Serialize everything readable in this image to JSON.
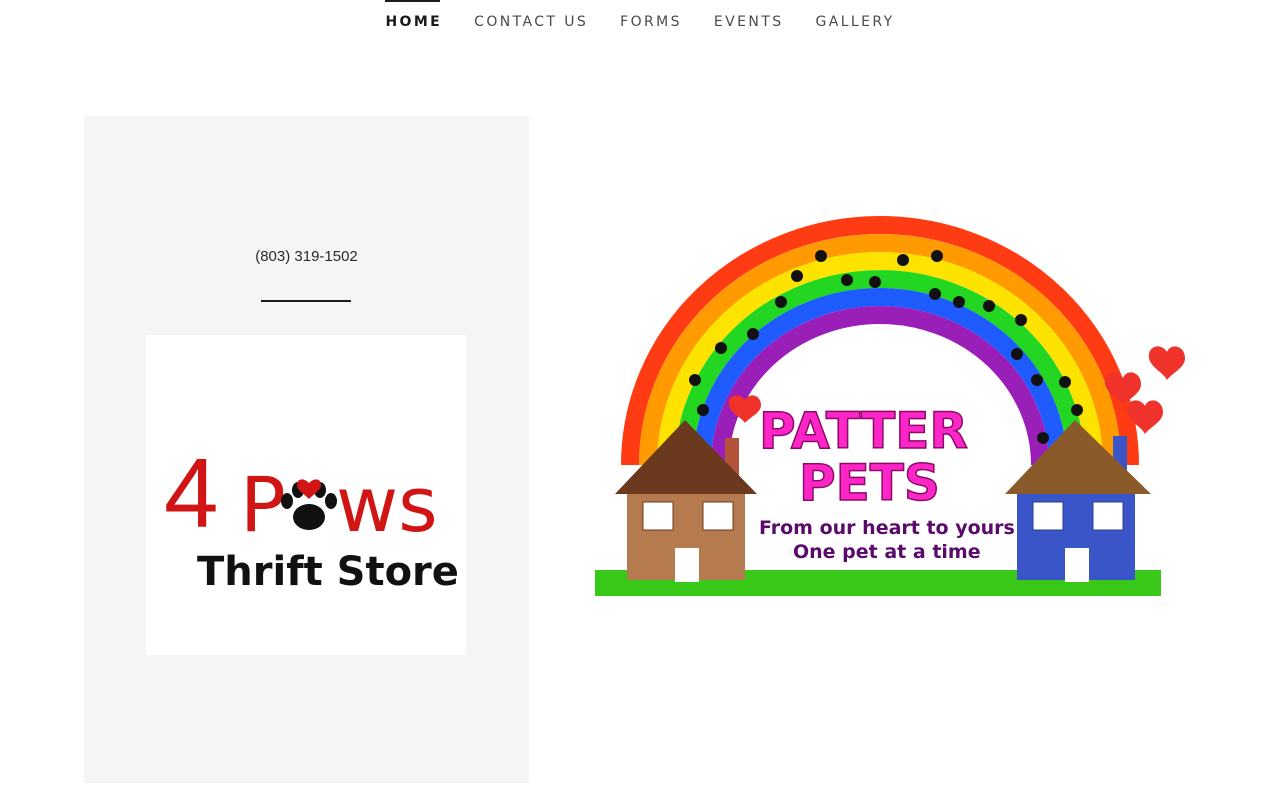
{
  "nav": {
    "items": [
      {
        "label": "HOME",
        "active": true
      },
      {
        "label": "CONTACT US",
        "active": false
      },
      {
        "label": "FORMS",
        "active": false
      },
      {
        "label": "EVENTS",
        "active": false
      },
      {
        "label": "GALLERY",
        "active": false
      }
    ]
  },
  "contact": {
    "phone": "(803) 319-1502"
  },
  "logo": {
    "text_top_number": "4",
    "text_top_word_start": "P",
    "text_top_word_end": "ws",
    "text_bottom": "Thrift Store",
    "colors": {
      "red": "#d11414",
      "black": "#111111"
    },
    "icon": "paw-heart-icon"
  },
  "hero": {
    "title_line1": "PATTER",
    "title_line2": "PETS",
    "tagline_line1": "From our heart to yours",
    "tagline_line2": "One pet at a time",
    "colors": {
      "rainbow": [
        "#ff3b14",
        "#ff9a00",
        "#ffe300",
        "#22d622",
        "#1e5cff",
        "#9a1fb8"
      ],
      "title": "#ff26c8",
      "tagline": "#5a0a6a",
      "grass": "#38c818",
      "heart": "#f0332a"
    }
  }
}
